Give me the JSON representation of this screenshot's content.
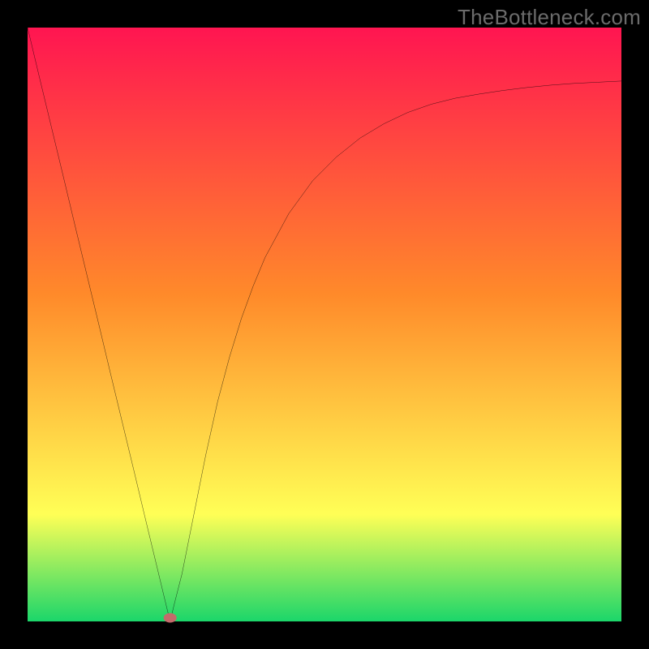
{
  "watermark": "TheBottleneck.com",
  "chart_data": {
    "type": "line",
    "title": "",
    "xlabel": "",
    "ylabel": "",
    "xlim": [
      0,
      1
    ],
    "ylim": [
      0,
      1
    ],
    "legend": false,
    "grid": false,
    "background_gradient": {
      "top": "#ff1551",
      "upper_mid": "#ff8a2a",
      "lower_mid": "#ffff56",
      "bottom": "#1bd66a"
    },
    "marker": {
      "x": 0.24,
      "y": 0.006,
      "color": "#c46b6b"
    },
    "series": [
      {
        "name": "curve",
        "color": "#000000",
        "x": [
          0.0,
          0.02,
          0.04,
          0.06,
          0.08,
          0.1,
          0.12,
          0.14,
          0.16,
          0.18,
          0.2,
          0.22,
          0.232,
          0.24,
          0.248,
          0.26,
          0.28,
          0.3,
          0.32,
          0.34,
          0.36,
          0.38,
          0.4,
          0.44,
          0.48,
          0.52,
          0.56,
          0.6,
          0.64,
          0.68,
          0.72,
          0.76,
          0.8,
          0.84,
          0.88,
          0.92,
          0.96,
          1.0
        ],
        "y": [
          1.0,
          0.916,
          0.833,
          0.75,
          0.666,
          0.583,
          0.5,
          0.416,
          0.333,
          0.25,
          0.166,
          0.083,
          0.033,
          0.0,
          0.033,
          0.08,
          0.18,
          0.28,
          0.37,
          0.445,
          0.51,
          0.565,
          0.613,
          0.687,
          0.742,
          0.782,
          0.814,
          0.838,
          0.857,
          0.871,
          0.881,
          0.888,
          0.894,
          0.899,
          0.903,
          0.906,
          0.908,
          0.91
        ]
      }
    ]
  }
}
